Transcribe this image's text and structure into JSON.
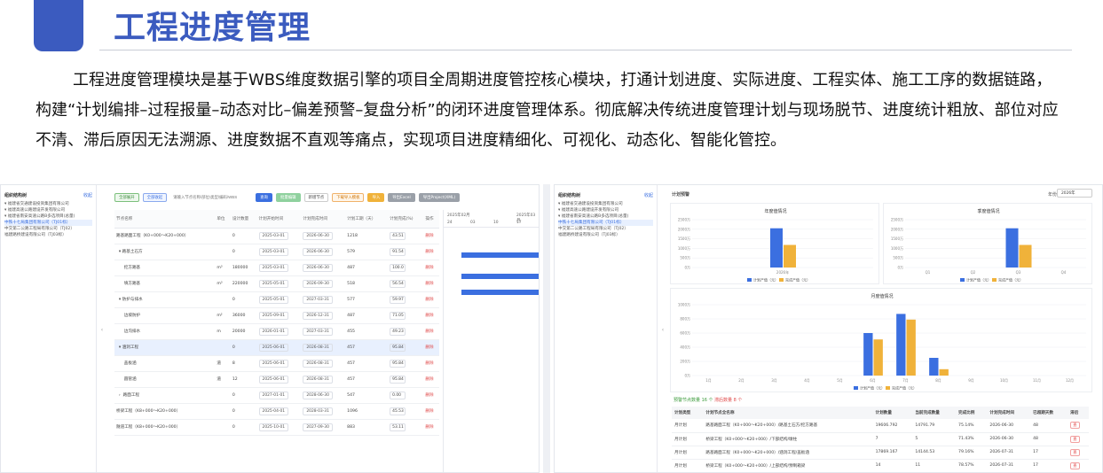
{
  "header": {
    "title": "工程进度管理",
    "intro": "工程进度管理模块是基于WBS维度数据引擎的项目全周期进度管控核心模块，打通计划进度、实际进度、工程实体、施工工序的数据链路，构建“计划编排–过程报量–动态对比–偏差预警–复盘分析”的闭环进度管理体系。彻底解决传统进度管理计划与现场脱节、进度统计粗放、部位对应不清、滞后原因无法溯源、进度数据不直观等痛点，实现项目进度精细化、可视化、动态化、智能化管控。"
  },
  "colors": {
    "accent": "#3b5bbf",
    "primary": "#3b6fe0",
    "secondary": "#f0b23a"
  },
  "left": {
    "tree_title": "组织结构树",
    "tree_link": "收起",
    "tree": [
      "▾ 福建省交通建设投资集团有限公司",
      "  ▾ 福建高速公路建设开发有限公司",
      "    ▾ 福建省南安高速公路B多选项目(总量)",
      "      中铁十七局集团有限公司（TJ01标）",
      "      中交第二公路工程局有限公司（TJ02）",
      "      福建路桥建设有限公司（TJ03标）"
    ],
    "toolbar": {
      "expand_all": "全部展开",
      "collapse_all": "全部收起",
      "search_placeholder": "请输入节点名称/部位/类型/编码/WBS",
      "search_btn": "查询",
      "batch_edit": "批量编辑",
      "add_node": "新增节点",
      "download_tpl": "下载导入模板",
      "import": "导入",
      "export_excel": "导出Excel",
      "export_project": "导出Project(XML)"
    },
    "columns": [
      "节点名称",
      "单位",
      "设计数量",
      "计划开始时间",
      "计划完成时间",
      "计划工期（天）",
      "计划完成(%)",
      "操作"
    ],
    "rows": [
      {
        "name": "路基路面工程（K0+000～K20+000）",
        "unit": "",
        "qty": "0",
        "start": "2025-03-01",
        "end": "2026-06-30",
        "days": "1218",
        "pct": "43.51",
        "op": "删除"
      },
      {
        "name": "  ▾ 路基土石方",
        "unit": "",
        "qty": "0",
        "start": "2025-03-01",
        "end": "2026-06-30",
        "days": "579",
        "pct": "91.54",
        "op": "删除"
      },
      {
        "name": "      挖方路基",
        "unit": "m³",
        "qty": "180000",
        "start": "2025-03-01",
        "end": "2026-06-30",
        "days": "487",
        "pct": "100.0",
        "op": "删除"
      },
      {
        "name": "      填方路基",
        "unit": "m³",
        "qty": "220000",
        "start": "2025-05-01",
        "end": "2026-09-30",
        "days": "518",
        "pct": "56.54",
        "op": "删除"
      },
      {
        "name": "  ▾ 防护与排水",
        "unit": "",
        "qty": "0",
        "start": "2025-05-01",
        "end": "2027-03-31",
        "days": "577",
        "pct": "59.97",
        "op": "删除"
      },
      {
        "name": "      边坡防护",
        "unit": "m²",
        "qty": "36000",
        "start": "2025-09-01",
        "end": "2026-12-31",
        "days": "487",
        "pct": "71.05",
        "op": "删除"
      },
      {
        "name": "      边沟排水",
        "unit": "m",
        "qty": "20000",
        "start": "2026-01-01",
        "end": "2027-03-31",
        "days": "455",
        "pct": "49.23",
        "op": "删除"
      },
      {
        "name": "  ▾ 涵洞工程",
        "unit": "",
        "qty": "0",
        "start": "2025-06-01",
        "end": "2026-08-31",
        "days": "457",
        "pct": "95.84",
        "op": "删除",
        "hl": true
      },
      {
        "name": "      盖板涵",
        "unit": "道",
        "qty": "8",
        "start": "2025-06-01",
        "end": "2026-08-31",
        "days": "457",
        "pct": "95.84",
        "op": "删除"
      },
      {
        "name": "      圆管涵",
        "unit": "道",
        "qty": "12",
        "start": "2025-06-01",
        "end": "2026-08-31",
        "days": "457",
        "pct": "95.84",
        "op": "删除"
      },
      {
        "name": "  ›  路面工程",
        "unit": "",
        "qty": "0",
        "start": "2027-01-01",
        "end": "2028-06-30",
        "days": "547",
        "pct": "0.00",
        "op": "删除"
      },
      {
        "name": "桥梁工程（K8+000～K20+000）",
        "unit": "",
        "qty": "0",
        "start": "2025-04-01",
        "end": "2028-03-31",
        "days": "1096",
        "pct": "45.53",
        "op": "删除"
      },
      {
        "name": "隧道工程（K8+000～K20+000）",
        "unit": "",
        "qty": "0",
        "start": "2025-10-01",
        "end": "2027-09-30",
        "days": "883",
        "pct": "53.11",
        "op": "删除"
      }
    ],
    "gantt": {
      "months": [
        "2025年02月",
        "2025年03月"
      ],
      "days": [
        "24",
        "03",
        "10",
        "17"
      ]
    }
  },
  "right": {
    "tree_title": "组织结构树",
    "tree_link": "收起",
    "tree": [
      "▾ 福建省交通建设投资集团有限公司",
      "  ▾ 福建高速公路建设开发有限公司",
      "    ▾ 福建省南安高速公路B多选项目(总量)",
      "      中铁十七局集团有限公司（TJ01标）",
      "      中交第二公路工程局有限公司（TJ02）",
      "      福建路桥建设有限公司（TJ03标）"
    ],
    "section_title": "计划预警",
    "year_label": "年份",
    "year_value": "2026年",
    "legend": [
      "计划产值（元）",
      "完成产值（元）"
    ],
    "chart_data": [
      {
        "type": "bar",
        "title": "年度值情况",
        "categories": [
          "2026年"
        ],
        "ylim": [
          0,
          2500
        ],
        "yticks": [
          "0万",
          "500万",
          "1000万",
          "1500万",
          "2000万",
          "2500万"
        ],
        "series": [
          {
            "name": "计划产值（元）",
            "values": [
              2050
            ]
          },
          {
            "name": "完成产值（元）",
            "values": [
              1180
            ]
          }
        ]
      },
      {
        "type": "bar",
        "title": "季度值情况",
        "categories": [
          "Q1",
          "Q2",
          "Q3",
          "Q4"
        ],
        "ylim": [
          0,
          2500
        ],
        "yticks": [
          "0万",
          "500万",
          "1000万",
          "1500万",
          "2000万",
          "2500万"
        ],
        "series": [
          {
            "name": "计划产值（元）",
            "values": [
              0,
              0,
              2050,
              0
            ]
          },
          {
            "name": "完成产值（元）",
            "values": [
              0,
              0,
              1180,
              0
            ]
          }
        ]
      },
      {
        "type": "bar",
        "title": "月度值情况",
        "categories": [
          "1月",
          "2月",
          "3月",
          "4月",
          "5月",
          "6月",
          "7月",
          "8月",
          "9月",
          "10月",
          "11月",
          "12月"
        ],
        "ylim": [
          0,
          1000
        ],
        "yticks": [
          "0万",
          "200万",
          "400万",
          "600万",
          "800万",
          "1000万"
        ],
        "series": [
          {
            "name": "计划产值（元）",
            "values": [
              0,
              0,
              0,
              0,
              0,
              600,
              870,
              250,
              0,
              0,
              0,
              0
            ]
          },
          {
            "name": "完成产值（元）",
            "values": [
              0,
              0,
              0,
              0,
              0,
              510,
              790,
              90,
              0,
              0,
              0,
              0
            ]
          }
        ]
      }
    ],
    "table": {
      "tabs": [
        "预警节点数量 16 个",
        "滞后数量 8 个"
      ],
      "columns": [
        "计划类型",
        "计划节点全名称",
        "计划数量",
        "当前完成数量",
        "完成比例",
        "计划完成时间",
        "已超期天数",
        "滞后"
      ],
      "rows": [
        [
          "月计划",
          "路基路面工程（K0+000～K20+000）/路基土石方/挖方路基",
          "19606.792",
          "14791.79",
          "75.14%",
          "2026-06-30",
          "48",
          "查"
        ],
        [
          "月计划",
          "桥梁工程（K0+000～K20+000）/下部结构/墩柱",
          "7",
          "5",
          "71.43%",
          "2026-06-30",
          "48",
          "查"
        ],
        [
          "月计划",
          "路基路面工程（K0+000～K20+000）/涵洞工程/盖板涵",
          "17869.167",
          "14144.53",
          "79.16%",
          "2026-07-31",
          "17",
          "查"
        ],
        [
          "月计划",
          "桥梁工程（K0+000～K20+000）/上部结构/预制箱梁",
          "14",
          "11",
          "78.57%",
          "2026-07-31",
          "17",
          "查"
        ]
      ]
    }
  }
}
